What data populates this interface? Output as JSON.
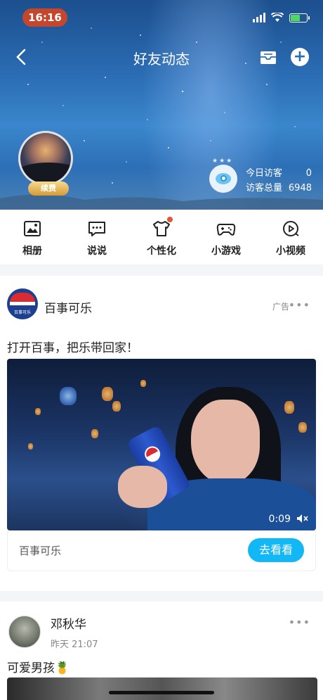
{
  "status_bar": {
    "time": "16:16"
  },
  "nav": {
    "title": "好友动态"
  },
  "profile": {
    "vip_label": "续费"
  },
  "visitors": {
    "today_label": "今日访客",
    "today_value": "0",
    "total_label": "访客总量",
    "total_value": "6948"
  },
  "menu": [
    {
      "label": "相册",
      "icon": "photo-album-icon"
    },
    {
      "label": "说说",
      "icon": "chat-bubble-icon"
    },
    {
      "label": "个性化",
      "icon": "t-shirt-icon",
      "has_dot": true
    },
    {
      "label": "小游戏",
      "icon": "gamepad-icon"
    },
    {
      "label": "小视频",
      "icon": "video-play-icon"
    }
  ],
  "ad": {
    "brand": "百事可乐",
    "logo_text": "百事可乐",
    "tag": "广告",
    "text": "打开百事，把乐带回家！",
    "video_time": "0:09",
    "footer_name": "百事可乐",
    "cta": "去看看"
  },
  "post": {
    "name": "邓秋华",
    "time": "昨天 21:07",
    "text": "可爱男孩🍍"
  },
  "colors": {
    "accent": "#12b7f5",
    "time_pill": "#c4462d",
    "dot": "#e0573a"
  }
}
